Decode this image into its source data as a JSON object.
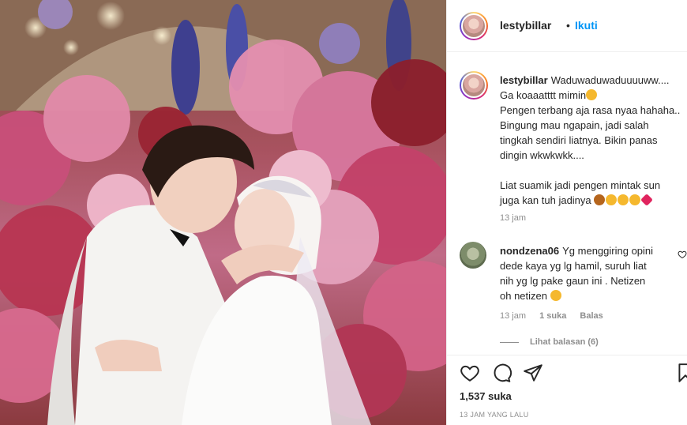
{
  "post": {
    "username": "lestybillar",
    "follow_label": "Ikuti",
    "separator": "•"
  },
  "caption": {
    "username": "lestybillar",
    "lines": [
      "Waduwaduwaduuuuww....",
      "Ga koaaatttt mimin",
      "Pengen terbang aja rasa nyaa hahaha..",
      "Bingung mau ngapain, jadi salah",
      "tingkah sendiri liatnya. Bikin panas",
      "dingin wkwkwkk....",
      "",
      "Liat suamik jadi pengen mintak sun",
      "juga kan tuh jadinya"
    ],
    "time": "13 jam"
  },
  "comment": {
    "username": "nondzena06",
    "lines": [
      "Yg menggiring opini",
      "dede kaya yg lg hamil, suruh liat",
      "nih yg lg pake gaun ini . Netizen",
      "oh netizen"
    ],
    "time": "13 jam",
    "likes": "1 suka",
    "reply": "Balas",
    "view_replies": "Lihat balasan (6)"
  },
  "footer": {
    "likes": "1,537 suka",
    "time_ago": "13 JAM YANG LALU"
  },
  "icons": [
    "heart-icon",
    "comment-icon",
    "share-icon",
    "bookmark-icon",
    "small-heart-icon"
  ],
  "colors": {
    "accent": "#0095f6",
    "muted": "#8e8e8e",
    "text": "#262626"
  }
}
